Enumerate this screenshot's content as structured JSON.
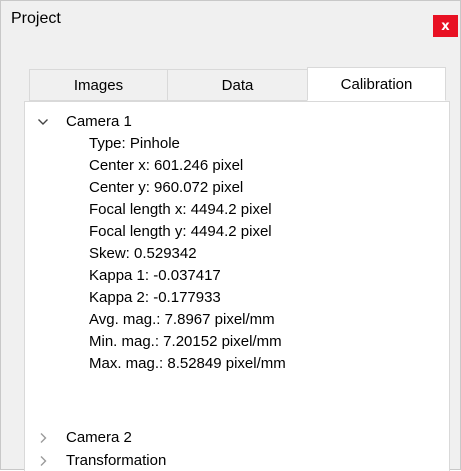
{
  "window": {
    "title": "Project",
    "close_label": "x"
  },
  "tabs": [
    {
      "label": "Images",
      "selected": false
    },
    {
      "label": "Data",
      "selected": false
    },
    {
      "label": "Calibration",
      "selected": true
    }
  ],
  "tree": {
    "camera1": {
      "label": "Camera 1",
      "expanded": true,
      "properties": [
        "Type: Pinhole",
        "Center x: 601.246 pixel",
        "Center y: 960.072 pixel",
        "Focal length x: 4494.2 pixel",
        "Focal length y: 4494.2 pixel",
        "Skew: 0.529342",
        "Kappa 1: -0.037417",
        "Kappa 2: -0.177933",
        "Avg. mag.: 7.8967 pixel/mm",
        "Min. mag.: 7.20152 pixel/mm",
        "Max. mag.: 8.52849 pixel/mm"
      ]
    },
    "camera2": {
      "label": "Camera 2",
      "expanded": false
    },
    "transformation": {
      "label": "Transformation",
      "expanded": false
    }
  },
  "colors": {
    "close_button": "#e81123",
    "window_bg": "#f0f0f0",
    "panel_bg": "#ffffff",
    "border": "#d9d9d9"
  }
}
